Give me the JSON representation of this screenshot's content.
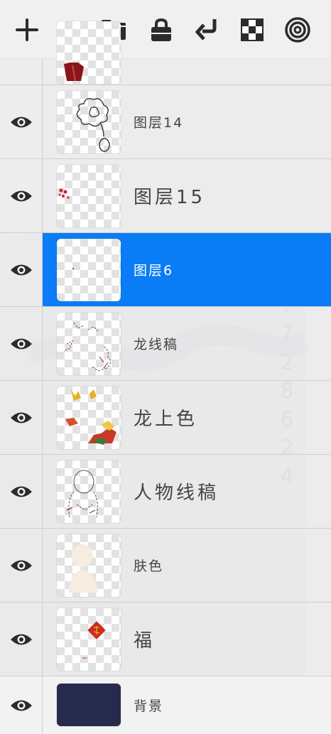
{
  "toolbar": {
    "buttons": [
      {
        "name": "add-layer-button",
        "icon": "plus-icon"
      },
      {
        "name": "group-button",
        "icon": "folder-icon"
      },
      {
        "name": "lock-button",
        "icon": "lock-icon"
      },
      {
        "name": "merge-down-button",
        "icon": "arrow-down-left-icon"
      },
      {
        "name": "alpha-lock-button",
        "icon": "checkerboard-icon"
      },
      {
        "name": "clipping-mask-button",
        "icon": "concentric-circles-icon"
      }
    ]
  },
  "layers": [
    {
      "label": "",
      "visible": true,
      "selected": false,
      "partial": true
    },
    {
      "label": "图层14",
      "visible": true,
      "selected": false
    },
    {
      "label": "图层15",
      "visible": true,
      "selected": false
    },
    {
      "label": "图层6",
      "visible": true,
      "selected": true
    },
    {
      "label": "龙线稿",
      "visible": true,
      "selected": false
    },
    {
      "label": "龙上色",
      "visible": true,
      "selected": false
    },
    {
      "label": "人物线稿",
      "visible": true,
      "selected": false
    },
    {
      "label": "肤色",
      "visible": true,
      "selected": false
    },
    {
      "label": "福",
      "visible": true,
      "selected": false
    },
    {
      "label": "背景",
      "visible": true,
      "selected": false
    }
  ],
  "colors": {
    "selected": "#0a7cf6",
    "background_layer": "#262b4e",
    "icon": "#2b2b2b"
  }
}
